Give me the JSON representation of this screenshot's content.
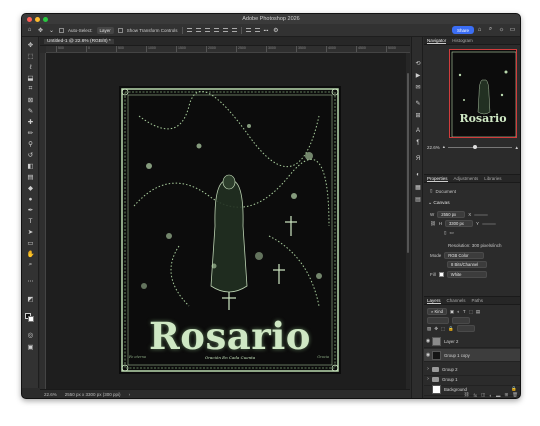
{
  "window": {
    "title": "Adobe Photoshop 2026"
  },
  "options_bar": {
    "auto_select_label": "Auto-Select:",
    "auto_select_value": "Layer",
    "show_transform_label": "Show Transform Controls",
    "more_label": "•••",
    "share_label": "Share"
  },
  "document": {
    "tab_label": "Untitled-1 @ 22.6% (RGB/8) *",
    "zoom": "22.6%",
    "status_info": "2550 px x 3300 px (300 ppi)",
    "ruler_ticks": [
      "500",
      "0",
      "500",
      "1000",
      "1500",
      "2000",
      "2500",
      "3000",
      "3500",
      "4000",
      "4500",
      "5000",
      "5500"
    ]
  },
  "poster": {
    "title": "Rosario",
    "subtitle_line": "Oración En Cada Cuenta",
    "small_left": "Fe eterna",
    "small_right": "Gracia",
    "accent_color": "#cfe8c4",
    "background_color": "#0c0c0c"
  },
  "navigator": {
    "tabs": [
      "Navigator",
      "Histogram"
    ],
    "zoom": "22.6%"
  },
  "properties": {
    "tabs": [
      "Properties",
      "Adjustments",
      "Libraries"
    ],
    "doc_label": "Document",
    "canvas_section": "Canvas",
    "width_label": "W",
    "width_value": "2550 px",
    "height_label": "H",
    "height_value": "3300 px",
    "x_label": "X",
    "y_label": "Y",
    "resolution": "Resolution: 300 pixels/inch",
    "mode_label": "Mode",
    "mode_value": "RGB Color",
    "depth_value": "8 Bits/Channel",
    "fill_label": "Fill",
    "fill_value": "White"
  },
  "layers": {
    "tabs": [
      "Layers",
      "Channels",
      "Paths"
    ],
    "kind_label": "Kind",
    "items": [
      {
        "name": "Layer 2",
        "thumb": "gray",
        "visible": true,
        "folder": false
      },
      {
        "name": "Group 1 copy",
        "thumb": "dark",
        "visible": true,
        "folder": false
      },
      {
        "name": "Group 2",
        "thumb": "",
        "visible": false,
        "folder": true
      },
      {
        "name": "Group 1",
        "thumb": "",
        "visible": false,
        "folder": true
      },
      {
        "name": "Background",
        "thumb": "white",
        "visible": false,
        "folder": false
      }
    ]
  },
  "colors": {
    "share_blue": "#3b6ef5",
    "nav_frame_red": "#d23c3c"
  }
}
